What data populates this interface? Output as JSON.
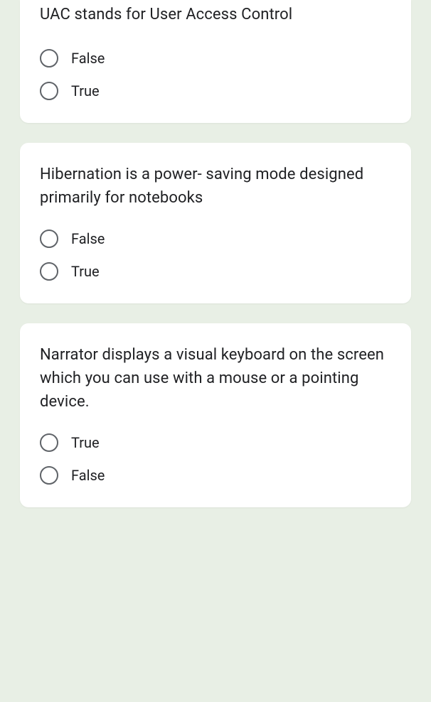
{
  "questions": [
    {
      "text": "UAC stands for User Access Control",
      "options": [
        "False",
        "True"
      ]
    },
    {
      "text": "Hibernation is a power- saving mode designed primarily for notebooks",
      "options": [
        "False",
        "True"
      ]
    },
    {
      "text": "Narrator displays a visual keyboard on the screen which you can use with a mouse or a pointing device.",
      "options": [
        "True",
        "False"
      ]
    }
  ]
}
